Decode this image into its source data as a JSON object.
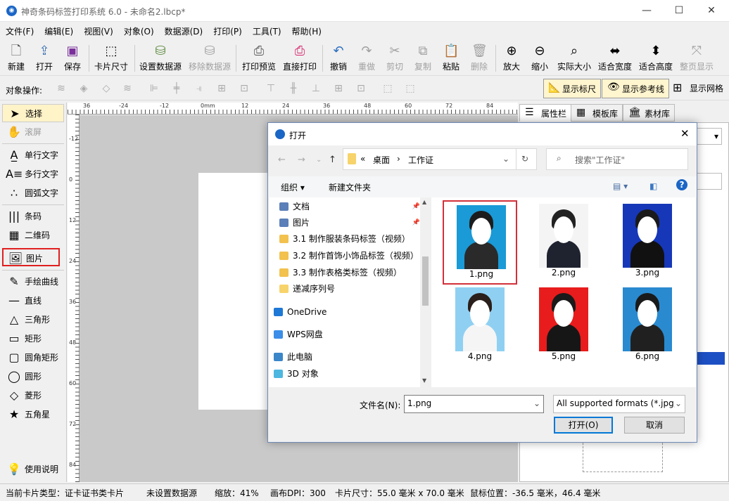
{
  "window": {
    "title": "神奇条码标签打印系统 6.0 - 未命名2.lbcp*",
    "min": "—",
    "max": "☐",
    "close": "✕"
  },
  "menu": [
    "文件(F)",
    "编辑(E)",
    "视图(V)",
    "对象(O)",
    "数据源(D)",
    "打印(P)",
    "工具(T)",
    "帮助(H)"
  ],
  "toolbar": {
    "new": "新建",
    "open": "打开",
    "save": "保存",
    "card_size": "卡片尺寸",
    "set_datasource": "设置数据源",
    "remove_datasource": "移除数据源",
    "print_preview": "打印预览",
    "print": "直接打印",
    "undo": "撤销",
    "redo": "重做",
    "cut": "剪切",
    "copy": "复制",
    "paste": "粘贴",
    "delete": "删除",
    "zoom_in": "放大",
    "zoom_out": "缩小",
    "actual_size": "实际大小",
    "fit_width": "适合宽度",
    "fit_height": "适合高度",
    "fit_page": "整页显示"
  },
  "objbar": {
    "label": "对象操作:",
    "show_ruler": "显示标尺",
    "show_guides": "显示参考线",
    "show_grid": "显示网格"
  },
  "tools": {
    "select": "选择",
    "scroll": "滚屏",
    "single_text": "单行文字",
    "multi_text": "多行文字",
    "arc_text": "圆弧文字",
    "barcode": "条码",
    "qrcode": "二维码",
    "image": "图片",
    "freehand": "手绘曲线",
    "line": "直线",
    "triangle": "三角形",
    "rect": "矩形",
    "round_rect": "圆角矩形",
    "circle": "圆形",
    "diamond": "菱形",
    "star": "五角星",
    "help": "使用说明"
  },
  "ruler": {
    "h": [
      "36",
      "-24",
      "-12",
      "0mm",
      "12",
      "24",
      "36",
      "48",
      "60",
      "72",
      "84"
    ],
    "v": [
      "-12",
      "0",
      "12",
      "24",
      "36",
      "48",
      "60",
      "72",
      "84"
    ]
  },
  "rpanel": {
    "tab_props": "属性栏",
    "tab_templates": "模板库",
    "tab_assets": "素材库"
  },
  "status": {
    "card_type": "当前卡片类型：证卡证书类卡片",
    "datasource": "未设置数据源",
    "zoom": "缩放：41%",
    "dpi": "画布DPI：300",
    "card_size": "卡片尺寸：55.0 毫米 x 70.0 毫米",
    "mouse": "鼠标位置：-36.5 毫米，46.4 毫米"
  },
  "dialog": {
    "title": "打开",
    "path": {
      "prefix": "«",
      "part1": "桌面",
      "sep": "›",
      "part2": "工作证"
    },
    "search_placeholder": "搜索\"工作证\"",
    "organize": "组织 ▾",
    "new_folder": "新建文件夹",
    "tree": [
      {
        "label": "文档",
        "color": "#5b7fb8"
      },
      {
        "label": "图片",
        "color": "#5b7fb8"
      },
      {
        "label": "3.1 制作服装条码标签（视频）",
        "color": "#f2c14e"
      },
      {
        "label": "3.2 制作首饰小饰品标签（视频）",
        "color": "#f2c14e"
      },
      {
        "label": "3.3 制作表格类标签（视频）",
        "color": "#f2c14e"
      },
      {
        "label": "递减序列号",
        "color": "#f7d36b"
      },
      {
        "label": "OneDrive",
        "color": "#1e78d6"
      },
      {
        "label": "WPS网盘",
        "color": "#3c8ee8"
      },
      {
        "label": "此电脑",
        "color": "#3a86c8"
      },
      {
        "label": "3D 对象",
        "color": "#4db7e0"
      }
    ],
    "files": [
      {
        "name": "1.png",
        "bg": "#1a9ad6",
        "hair": "#1c1c1c",
        "body": "#2a2a2a"
      },
      {
        "name": "2.png",
        "bg": "#f4f4f4",
        "hair": "#222",
        "body": "#1f2330"
      },
      {
        "name": "3.png",
        "bg": "#1637b8",
        "hair": "#1a1a1a",
        "body": "#111"
      },
      {
        "name": "4.png",
        "bg": "#8fd0f2",
        "hair": "#2a1f1a",
        "body": "#f5f5f5"
      },
      {
        "name": "5.png",
        "bg": "#e81c1c",
        "hair": "#1a1a1a",
        "body": "#161616"
      },
      {
        "name": "6.png",
        "bg": "#2a8ad0",
        "hair": "#1a1a1a",
        "body": "#202020"
      }
    ],
    "filename_label": "文件名(N):",
    "filename_value": "1.png",
    "filter": "All supported formats (*.jpg;",
    "open_button": "打开(O)",
    "cancel_button": "取消"
  }
}
